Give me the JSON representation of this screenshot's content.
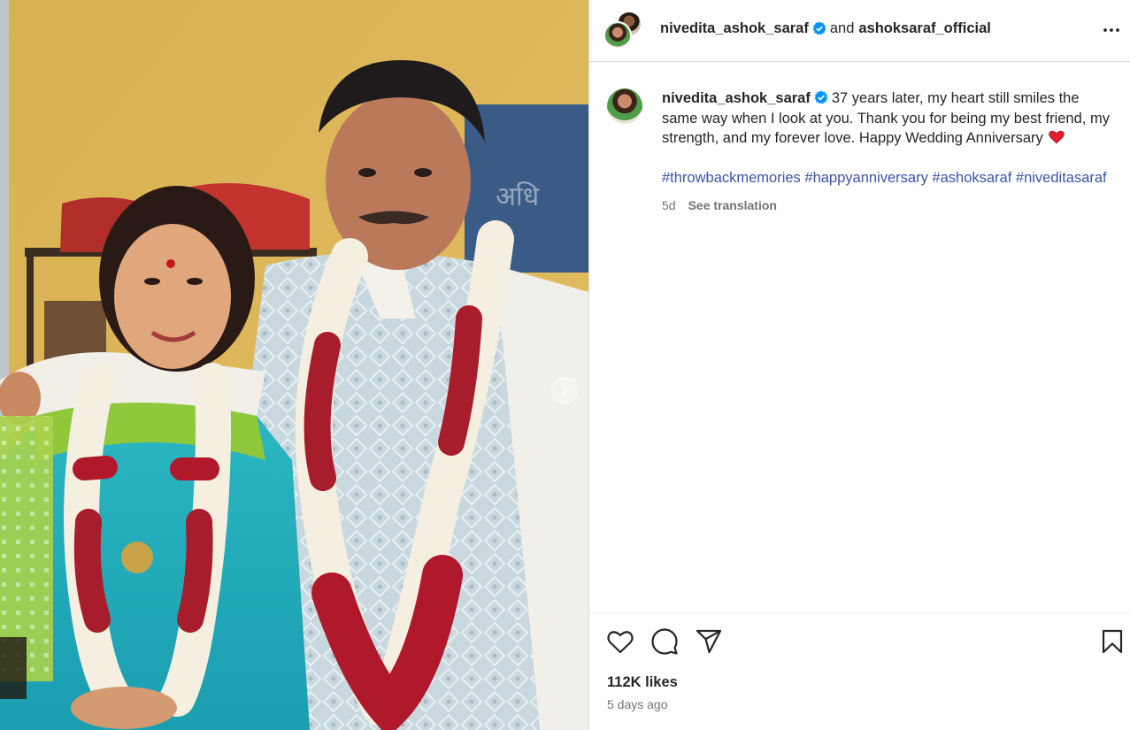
{
  "post": {
    "author": "nivedita_ashok_saraf",
    "joiner": "and",
    "collaborator": "ashoksaraf_official",
    "caption_author": "nivedita_ashok_saraf",
    "caption": "37 years later, my heart still smiles the same way when I look at you. Thank you for being my best friend, my strength, and my forever love. Happy Wedding Anniversary",
    "caption_emoji": "heart-emoji",
    "hashtags": [
      "#throwbackmemories",
      "#happyanniversary",
      "#ashoksaraf",
      "#niveditasaraf"
    ],
    "age": "5d",
    "see_translation": "See translation",
    "likes": "112K likes",
    "timestamp": "5 days ago"
  },
  "icons": {
    "verified": "verified-badge-icon",
    "more": "more-options-icon",
    "like": "heart-outline-icon",
    "comment": "comment-bubble-icon",
    "share": "paper-plane-icon",
    "save": "bookmark-icon",
    "next": "chevron-right-icon"
  },
  "colors": {
    "verified": "#0095f6",
    "hashtag": "#3d53a8",
    "muted": "#737373",
    "text": "#262626",
    "divider": "#dbdbdb",
    "heart_emoji": "#e0202b"
  }
}
